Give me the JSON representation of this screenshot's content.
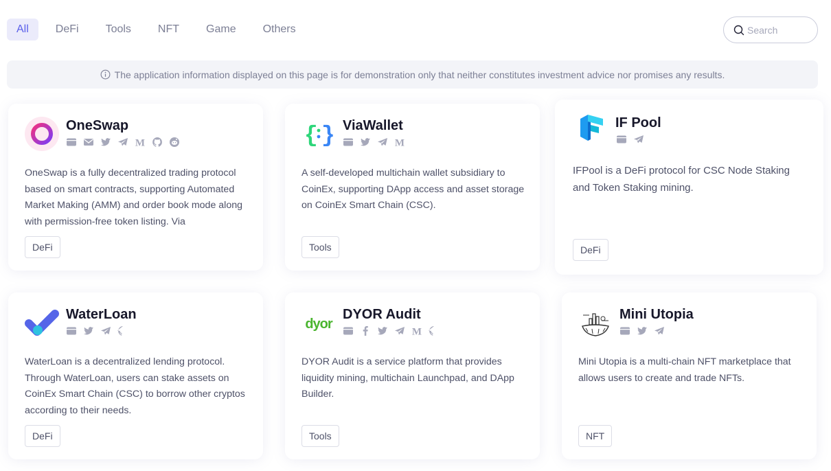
{
  "tabs": [
    "All",
    "DeFi",
    "Tools",
    "NFT",
    "Game",
    "Others"
  ],
  "search": {
    "placeholder": "Search"
  },
  "notice": "The application information displayed on this page is for demonstration only that neither constitutes investment advice nor promises any results.",
  "cards": [
    {
      "name": "OneSwap",
      "icons": [
        "website-icon",
        "email-icon",
        "twitter-icon",
        "telegram-icon",
        "medium-icon",
        "github-icon",
        "reddit-icon"
      ],
      "description": "OneSwap is a fully decentralized trading protocol based on smart contracts, supporting Automated Market Making (AMM) and order book mode along with permission-free token listing. Via",
      "tag": "DeFi"
    },
    {
      "name": "ViaWallet",
      "icons": [
        "website-icon",
        "twitter-icon",
        "telegram-icon",
        "medium-icon"
      ],
      "description": "A self-developed multichain wallet subsidiary to CoinEx, supporting DApp access and asset storage on CoinEx Smart Chain (CSC).",
      "tag": "Tools"
    },
    {
      "name": "IF Pool",
      "icons": [
        "website-icon",
        "telegram-icon"
      ],
      "description": "IFPool is a DeFi protocol for CSC Node Staking and Token Staking mining.",
      "tag": "DeFi"
    },
    {
      "name": "WaterLoan",
      "icons": [
        "website-icon",
        "twitter-icon",
        "telegram-icon",
        "github-icon"
      ],
      "description": "WaterLoan is a decentralized lending protocol. Through WaterLoan, users can stake assets on CoinEx Smart Chain (CSC) to borrow other cryptos according to their needs.",
      "tag": "DeFi"
    },
    {
      "name": "DYOR Audit",
      "icons": [
        "website-icon",
        "facebook-icon",
        "twitter-icon",
        "telegram-icon",
        "medium-icon",
        "github-icon"
      ],
      "description": "DYOR Audit is a service platform that provides liquidity mining, multichain Launchpad, and DApp Builder.",
      "tag": "Tools"
    },
    {
      "name": "Mini Utopia",
      "icons": [
        "website-icon",
        "twitter-icon",
        "telegram-icon"
      ],
      "description": "Mini Utopia is a multi-chain NFT marketplace that allows users to create and trade NFTs.",
      "tag": "NFT"
    }
  ],
  "colors": {
    "accent": "#5b60ea",
    "tab_active_bg": "#ebebfb",
    "muted_text": "#7c7f95",
    "icon_gray": "#a6a8ba"
  }
}
